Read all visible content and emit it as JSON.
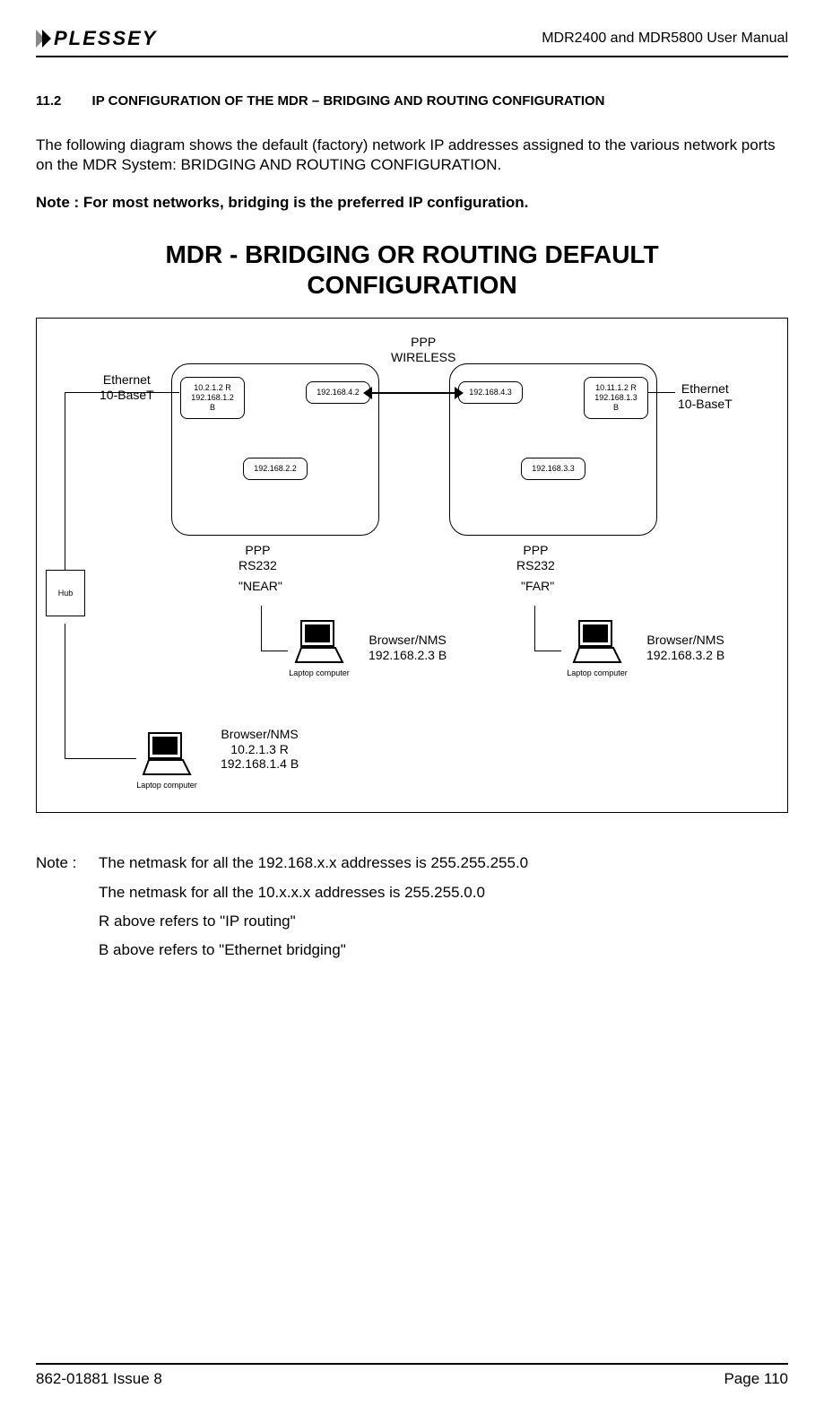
{
  "header": {
    "logo_text": "PLESSEY",
    "manual_title": "MDR2400 and MDR5800 User Manual"
  },
  "section": {
    "number": "11.2",
    "title": "IP CONFIGURATION OF THE MDR – BRIDGING AND ROUTING CONFIGURATION"
  },
  "paragraphs": {
    "intro": "The following diagram shows the default (factory) network IP addresses assigned to the various network ports on the MDR System: BRIDGING AND ROUTING CONFIGURATION.",
    "note_bold": "Note : For most networks, bridging is the preferred IP configuration."
  },
  "diagram": {
    "title_line1": "MDR - BRIDGING OR ROUTING DEFAULT",
    "title_line2": "CONFIGURATION",
    "labels": {
      "ppp_wireless": "PPP\nWIRELESS",
      "eth_left": "Ethernet\n10-BaseT",
      "eth_right": "Ethernet\n10-BaseT",
      "ppp_rs232_left": "PPP\nRS232",
      "ppp_rs232_right": "PPP\nRS232",
      "near": "\"NEAR\"",
      "far": "\"FAR\"",
      "hub": "Hub",
      "laptop_caption": "Laptop computer"
    },
    "ip": {
      "near_eth": "10.2.1.2 R\n192.168.1.2\nB",
      "near_wireless": "192.168.4.2",
      "near_rs232": "192.168.2.2",
      "far_eth": "10.11.1.2 R\n192.168.1.3\nB",
      "far_wireless": "192.168.4.3",
      "far_rs232": "192.168.3.3"
    },
    "browsers": {
      "near_rs232": "Browser/NMS\n192.168.2.3 B",
      "far_rs232": "Browser/NMS\n192.168.3.2 B",
      "eth": "Browser/NMS\n10.2.1.3 R\n192.168.1.4 B"
    }
  },
  "notes": {
    "label": "Note :",
    "line1": "The netmask for all the 192.168.x.x addresses is 255.255.255.0",
    "line2": "The netmask for all the 10.x.x.x addresses is 255.255.0.0",
    "line3": "R above refers to \"IP routing\"",
    "line4": "B above refers to \"Ethernet bridging\""
  },
  "footer": {
    "left": "862-01881 Issue 8",
    "right": "Page 110"
  }
}
